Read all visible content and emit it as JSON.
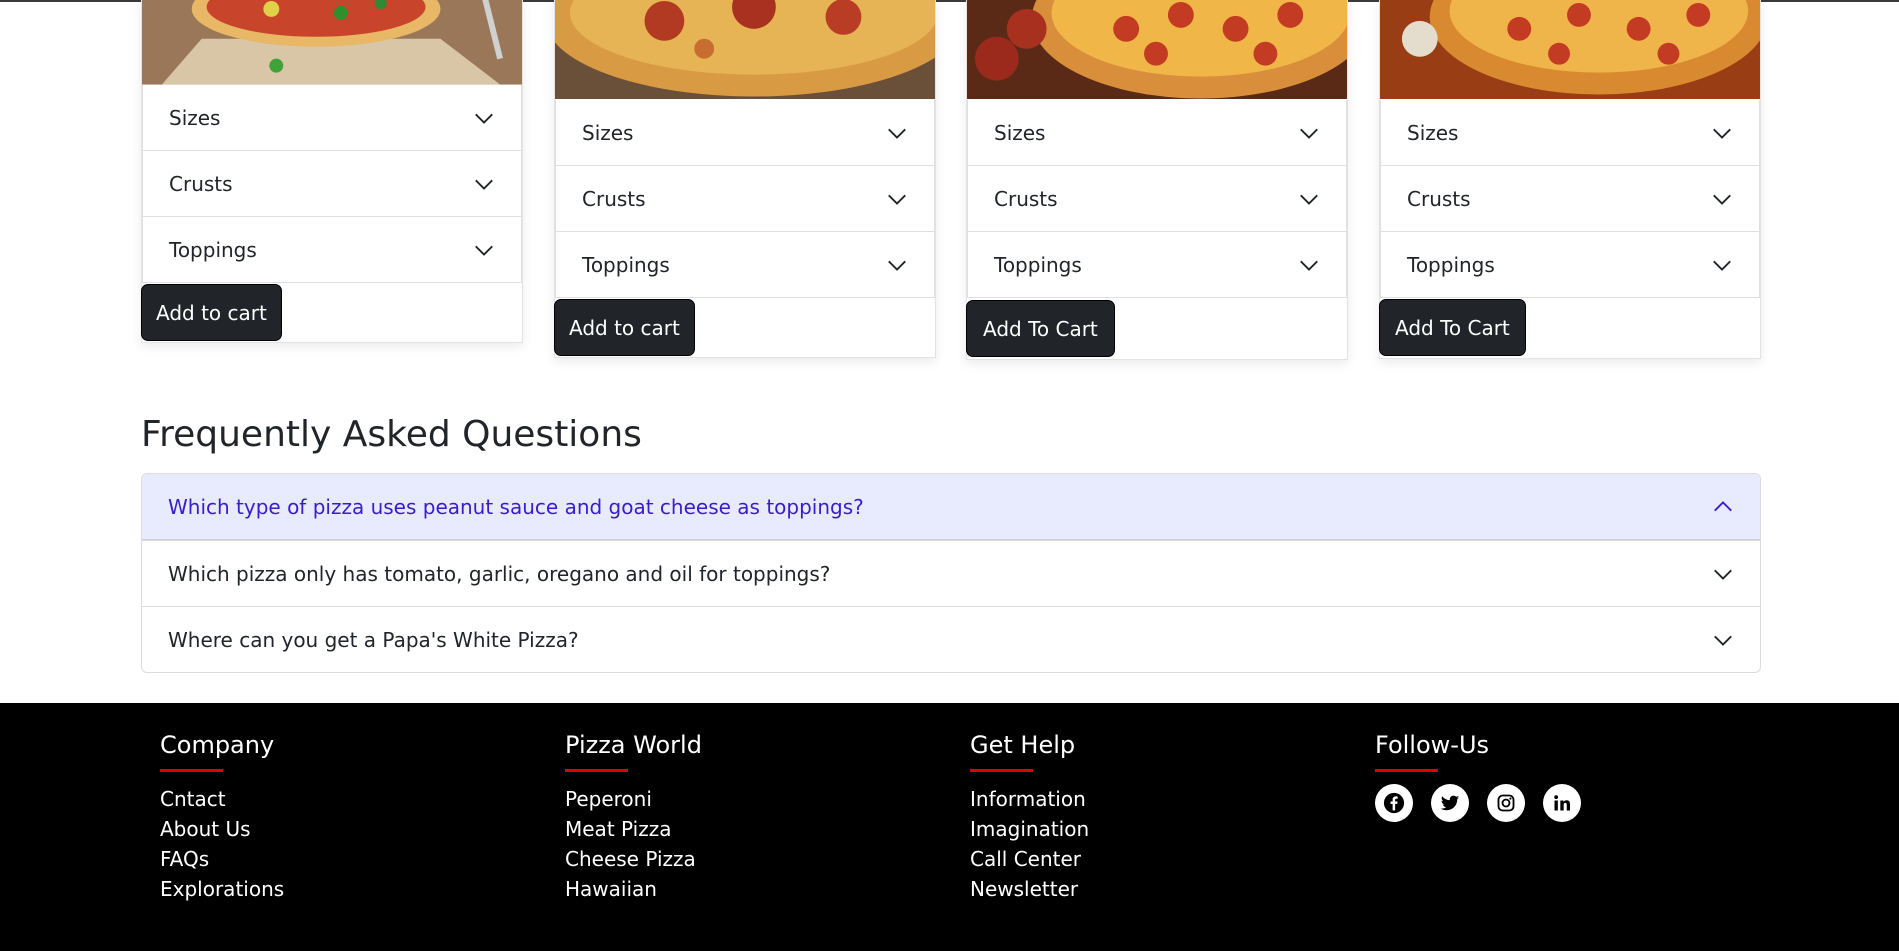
{
  "cards": [
    {
      "accordion": [
        "Sizes",
        "Crusts",
        "Toppings"
      ],
      "button": "Add to cart"
    },
    {
      "accordion": [
        "Sizes",
        "Crusts",
        "Toppings"
      ],
      "button": "Add to cart"
    },
    {
      "accordion": [
        "Sizes",
        "Crusts",
        "Toppings"
      ],
      "button": "Add To Cart"
    },
    {
      "accordion": [
        "Sizes",
        "Crusts",
        "Toppings"
      ],
      "button": "Add To Cart"
    }
  ],
  "faq": {
    "title": "Frequently Asked Questions",
    "items": [
      "Which type of pizza uses peanut sauce and goat cheese as toppings?",
      "Which pizza only has tomato, garlic, oregano and oil for toppings?",
      "Where can you get a Papa's White Pizza?"
    ]
  },
  "footer": {
    "columns": [
      {
        "title": "Company",
        "links": [
          "Cntact",
          "About Us",
          "FAQs",
          "Explorations"
        ]
      },
      {
        "title": "Pizza World",
        "links": [
          "Peperoni",
          "Meat Pizza",
          "Cheese Pizza",
          "Hawaiian"
        ]
      },
      {
        "title": "Get Help",
        "links": [
          "Information",
          "Imagination",
          "Call Center",
          "Newsletter"
        ]
      }
    ],
    "follow_title": "Follow-Us",
    "socials": [
      "facebook-icon",
      "twitter-icon",
      "instagram-icon",
      "linkedin-icon"
    ]
  },
  "colors": {
    "accent_bar": "#e10000",
    "faq_active_bg": "#e7ebfd",
    "faq_active_text": "#3b1ccc",
    "button_bg": "#212529",
    "footer_bg": "#000000"
  }
}
